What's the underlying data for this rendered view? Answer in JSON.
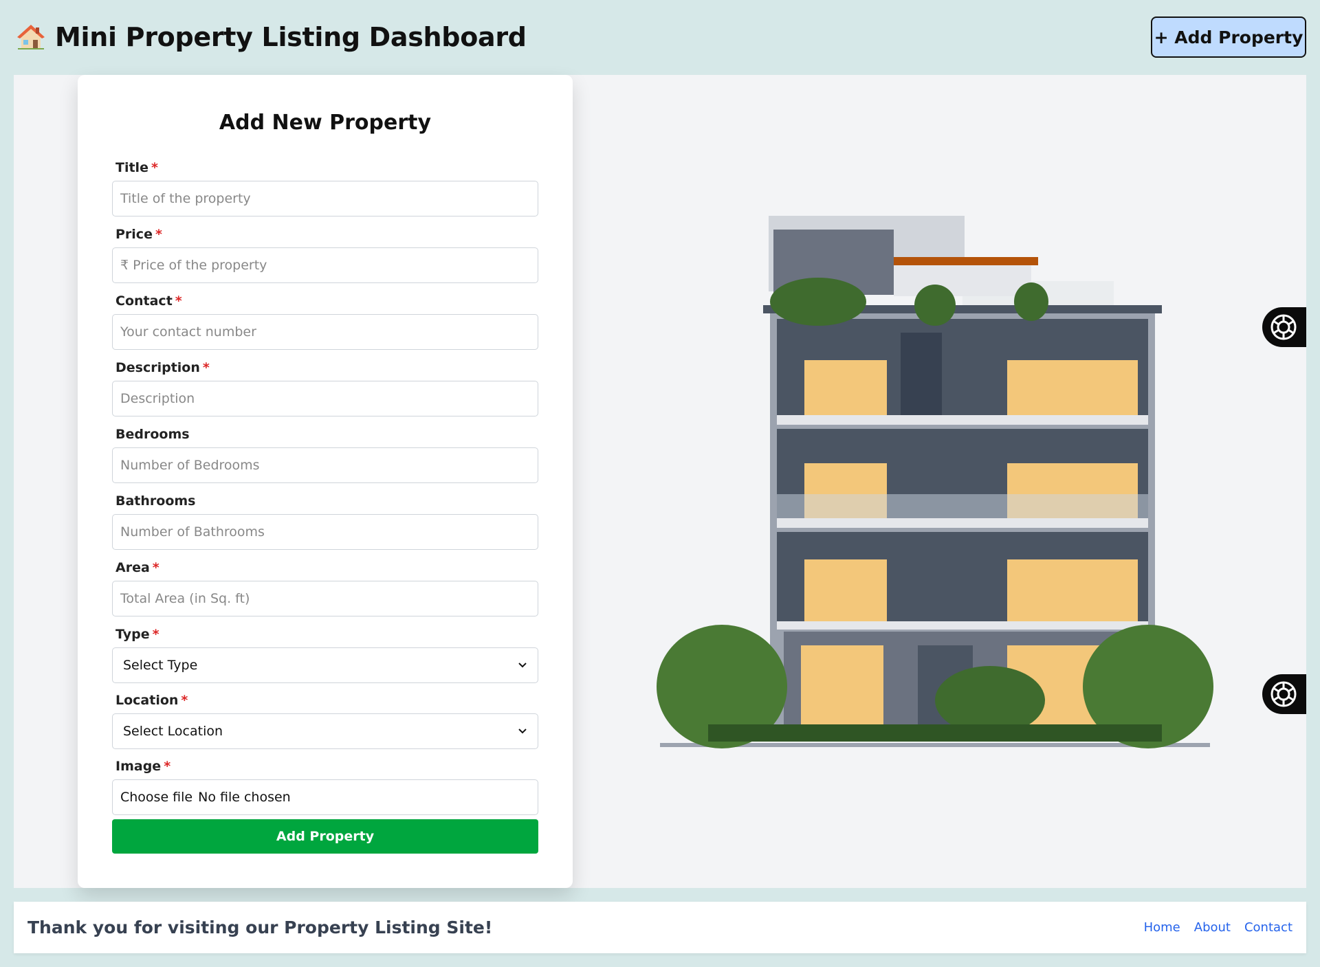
{
  "header": {
    "title": "Mini Property Listing Dashboard",
    "add_button_label": "+ Add Property",
    "icon": "house-icon"
  },
  "form": {
    "heading": "Add New Property",
    "fields": [
      {
        "label": "Title",
        "required": true,
        "placeholder": "Title of the property"
      },
      {
        "label": "Price",
        "required": true,
        "placeholder": "₹ Price of the property"
      },
      {
        "label": "Contact",
        "required": true,
        "placeholder": "Your contact number"
      },
      {
        "label": "Description",
        "required": true,
        "placeholder": "Description"
      },
      {
        "label": "Bedrooms",
        "required": false,
        "placeholder": "Number of Bedrooms"
      },
      {
        "label": "Bathrooms",
        "required": false,
        "placeholder": "Number of Bathrooms"
      },
      {
        "label": "Area",
        "required": true,
        "placeholder": "Total Area (in Sq. ft)"
      }
    ],
    "type": {
      "label": "Type",
      "required": true,
      "selected": "Select Type"
    },
    "location": {
      "label": "Location",
      "required": true,
      "selected": "Select Location"
    },
    "image": {
      "label": "Image",
      "required": true,
      "button": "Choose file",
      "status": "No file chosen"
    },
    "required_marker": "*",
    "submit_label": "Add Property"
  },
  "footer": {
    "text": "Thank you for visiting our Property Listing Site!",
    "links": [
      "Home",
      "About",
      "Contact"
    ]
  },
  "colors": {
    "background": "#d6e8e8",
    "add_button_bg": "#bfdbfe",
    "submit_bg": "#00a63e",
    "required": "#dc2626",
    "link": "#2563eb"
  }
}
